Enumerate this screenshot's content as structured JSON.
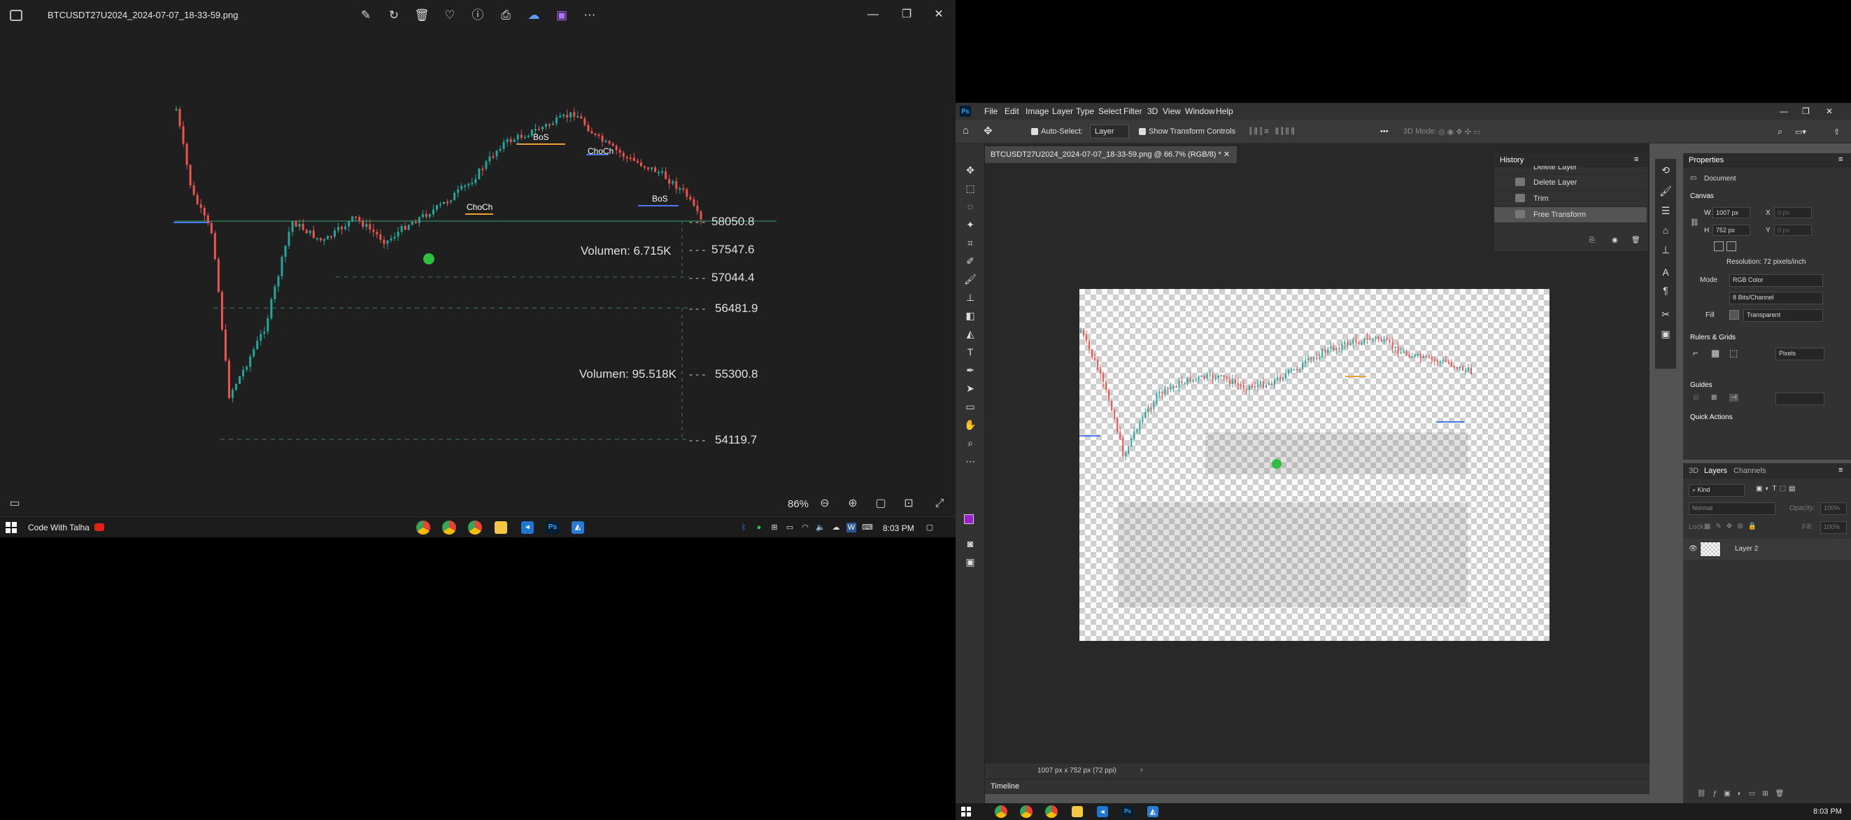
{
  "photos": {
    "filename": "BTCUSDT27U2024_2024-07-07_18-33-59.png",
    "toolbar_icons": [
      "edit-icon",
      "rotate-icon",
      "delete-icon",
      "favorite-icon",
      "info-icon",
      "print-icon",
      "cloud-icon",
      "video-editor-icon",
      "more-icon"
    ],
    "zoom": "86%",
    "chart": {
      "price_levels": [
        "58050.8",
        "57547.6",
        "57044.4",
        "56481.9",
        "55300.8",
        "54119.7"
      ],
      "volume_labels": [
        "Volumen: 6.715K",
        "Volumen: 95.518K"
      ],
      "annotations": [
        "BoS",
        "ChoCh",
        "ChoCh",
        "BoS"
      ],
      "colors": {
        "up": "#26a69a",
        "down": "#ef5350",
        "bos_orange": "#f0a030",
        "bos_blue": "#4a78ff",
        "marker": "#2fbf40"
      }
    }
  },
  "taskbar_left": {
    "title": "Code With Talha",
    "time": "8:03 PM"
  },
  "photoshop": {
    "menus": [
      "File",
      "Edit",
      "Image",
      "Layer",
      "Type",
      "Select",
      "Filter",
      "3D",
      "View",
      "Window",
      "Help"
    ],
    "options": {
      "auto_select_label": "Auto-Select:",
      "auto_select_target": "Layer",
      "transform_controls_label": "Show Transform Controls",
      "mode_3d": "3D Mode:"
    },
    "doc_tab": "BTCUSDT27U2024_2024-07-07_18-33-59.png @ 66.7% (RGB/8) *",
    "doc_status": "1007 px x 752 px (72 ppi)",
    "timeline_label": "Timeline",
    "history": {
      "title": "History",
      "items": [
        "Delete Layer",
        "Delete Layer",
        "Trim",
        "Free Transform"
      ]
    },
    "properties": {
      "title": "Properties",
      "doc_label": "Document",
      "canvas_section": "Canvas",
      "w_label": "W",
      "w_value": "1007 px",
      "h_label": "H",
      "h_value": "752 px",
      "x_label": "X",
      "y_label": "Y",
      "x_placeholder": "0 px",
      "y_placeholder": "0 px",
      "resolution": "Resolution: 72 pixels/inch",
      "mode_label": "Mode",
      "mode_value": "RGB Color",
      "bits_value": "8 Bits/Channel",
      "fill_label": "Fill",
      "fill_value": "Transparent",
      "rulers_section": "Rulers & Grids",
      "units_value": "Pixels",
      "guides_section": "Guides",
      "quick_actions": "Quick Actions"
    },
    "layers": {
      "tabs": [
        "3D",
        "Layers",
        "Channels"
      ],
      "kind_filter": "Kind",
      "blend_mode": "Normal",
      "opacity_label": "Opacity:",
      "opacity_value": "100%",
      "lock_label": "Lock:",
      "fill_label": "Fill:",
      "fill_value": "100%",
      "layer_name": "Layer 2"
    }
  },
  "taskbar_right": {
    "time": "8:03 PM"
  }
}
